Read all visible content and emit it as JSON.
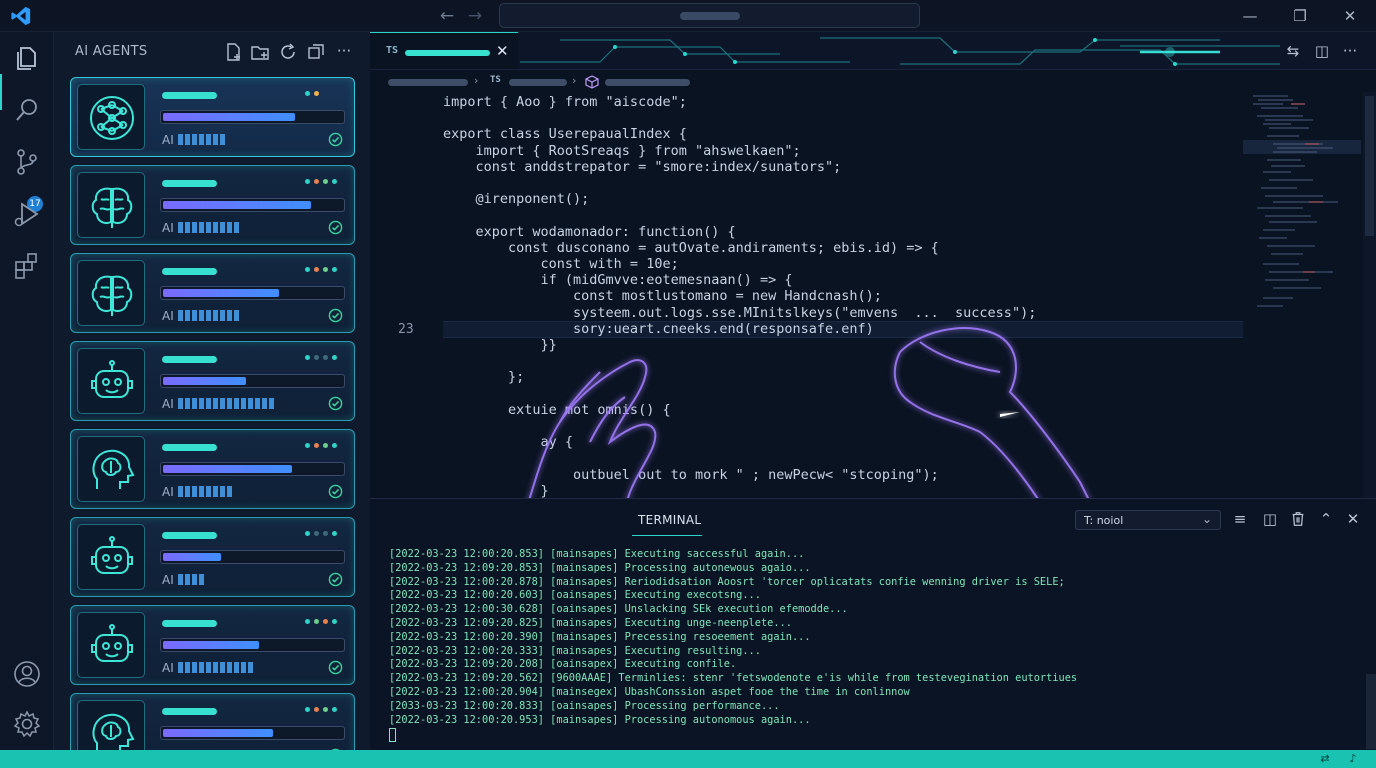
{
  "titlebar": {
    "back_icon": "arrow-left-icon",
    "forward_icon": "arrow-right-icon",
    "minimize": "—",
    "maximize": "❐",
    "close": "✕"
  },
  "activity_bar": {
    "items": [
      "explorer-icon",
      "search-icon",
      "source-control-icon",
      "run-debug-icon",
      "extensions-icon"
    ],
    "scm_badge": "17",
    "bottom": [
      "account-icon",
      "settings-gear-icon"
    ]
  },
  "sidebar": {
    "title": "AI AGENTS",
    "toolbar": [
      "new-file-icon",
      "new-folder-icon",
      "refresh-icon",
      "collapse-all-icon",
      "more-icon"
    ],
    "more_label": "···",
    "agents": [
      {
        "icon": "neural-network-icon",
        "progress": 0.73,
        "segments": 7,
        "status_dots": [
          "#2fd3c6",
          "#f0b24a"
        ],
        "label": "AI"
      },
      {
        "icon": "brain-icon",
        "progress": 0.82,
        "segments": 9,
        "status_dots": [
          "#2fd3c6",
          "#e7814f",
          "#6ad08a",
          "#2fd3c6"
        ],
        "label": "AI"
      },
      {
        "icon": "brain-icon",
        "progress": 0.64,
        "segments": 9,
        "status_dots": [
          "#2fd3c6",
          "#e7814f",
          "#6ad08a",
          "#2fd3c6"
        ],
        "label": "AI"
      },
      {
        "icon": "robot-icon",
        "progress": 0.46,
        "segments": 14,
        "status_dots": [
          "#2fd3c6",
          "#3d6a78",
          "#3d6a78",
          "#2fd3c6"
        ],
        "label": "AI"
      },
      {
        "icon": "head-brain-icon",
        "progress": 0.71,
        "segments": 8,
        "status_dots": [
          "#2fd3c6",
          "#e7814f",
          "#6ad08a",
          "#2fd3c6"
        ],
        "label": "AI"
      },
      {
        "icon": "robot-icon",
        "progress": 0.32,
        "segments": 4,
        "status_dots": [
          "#2fd3c6",
          "#3d6a78",
          "#3d6a78",
          "#2fd3c6"
        ],
        "label": "AI"
      },
      {
        "icon": "robot-icon",
        "progress": 0.53,
        "segments": 11,
        "status_dots": [
          "#2fd3c6",
          "#6ad08a",
          "#e7814f",
          "#2fd3c6"
        ],
        "label": "AI"
      },
      {
        "icon": "head-brain-icon",
        "progress": 0.61,
        "segments": 0,
        "status_dots": [
          "#2fd3c6",
          "#e7814f",
          "#6ad08a",
          "#2fd3c6"
        ],
        "label": "AI"
      }
    ]
  },
  "editor": {
    "tab": {
      "lang": "TS",
      "close": "✕"
    },
    "breadcrumb_lang": "TS",
    "actions": [
      "compare-icon",
      "split-editor-icon",
      "more-icon"
    ],
    "more_label": "···",
    "highlight_line_number": "23",
    "code": [
      "import { Aoo } from \"aiscode\";",
      "",
      "export class UserepaualIndex {",
      "    import { RootSreaqs } from \"ahswelkaen\";",
      "    const anddstrepator = \"smore:index/sunators\";",
      "",
      "    @irenponent();",
      "",
      "    export wodamonador: function() {",
      "        const dusconano = autOvate.andiraments; ebis.id) => {",
      "            const with = 10e;",
      "            if (midGmvve:eotemesnaan() => {",
      "                const mostlustomano = new Handcnash();",
      "                systeem.out.logs.sse.MInitslkeys(\"emvens  ...  success\");",
      "                sory:ueart.cneeks.end(responsafe.enf)",
      "            }}",
      "",
      "        };",
      "",
      "        extuie mot omnis() {",
      "",
      "            ay {",
      "",
      "                outbuel out to mork \" ; newPecw< \"stcoping\");",
      "            }"
    ]
  },
  "panel": {
    "tab": "TERMINAL",
    "terminal_select": "T: noiol",
    "actions": [
      "split-lines-icon",
      "split-terminal-icon",
      "trash-icon",
      "chevron-up-icon",
      "close-icon"
    ],
    "log": [
      "[2022-03-23 12:00:20.853] [mainsapes] Executing saccessful again...",
      "[2022-03-23 12:09:20.853] [mainsapes] Processing autonewous agaio...",
      "[2022-03-23 12:00:20.878] [mainsapes] Reriodidsation Aoosrt 'torcer oplicatats confie wenning driver is SELE;",
      "[2022-03-23 12:00:20.603] [oainsapes] Executing execotsng...",
      "[2022-03-23 12:00:30.628] [oainsapes] Unslacking SEk execution efemodde...",
      "[2022-03-23 12:09:20.825] [mainsapes] Executing unge-neenplete...",
      "[2022-03-23 12:00:20.390] [mainsapes] Precessing resoeement again...",
      "[2022-03-23 12:00:20.333] [mainsapes] Executing resulting...",
      "[2022-03-23 12:09:20.208] [oainsapex] Executing confile.",
      "[2022-03-23 12:09:20.562] [9600AAAE] Terminlies: stenr 'fetswodenote e'is while from testevegination eutortiues",
      "[2022-03-23 12:00:20.904] [mainsegex] UbashConssion aspet fooe the time in conlinnow",
      "[2033-03-23 12:00:20.833] [oainsapes] Processing performance...",
      "[2022-03-23 12:00:20.953] [mainsapes] Processing autonomous again..."
    ]
  },
  "statusbar": {
    "icons": [
      "remote-icon",
      "bell-icon"
    ]
  }
}
